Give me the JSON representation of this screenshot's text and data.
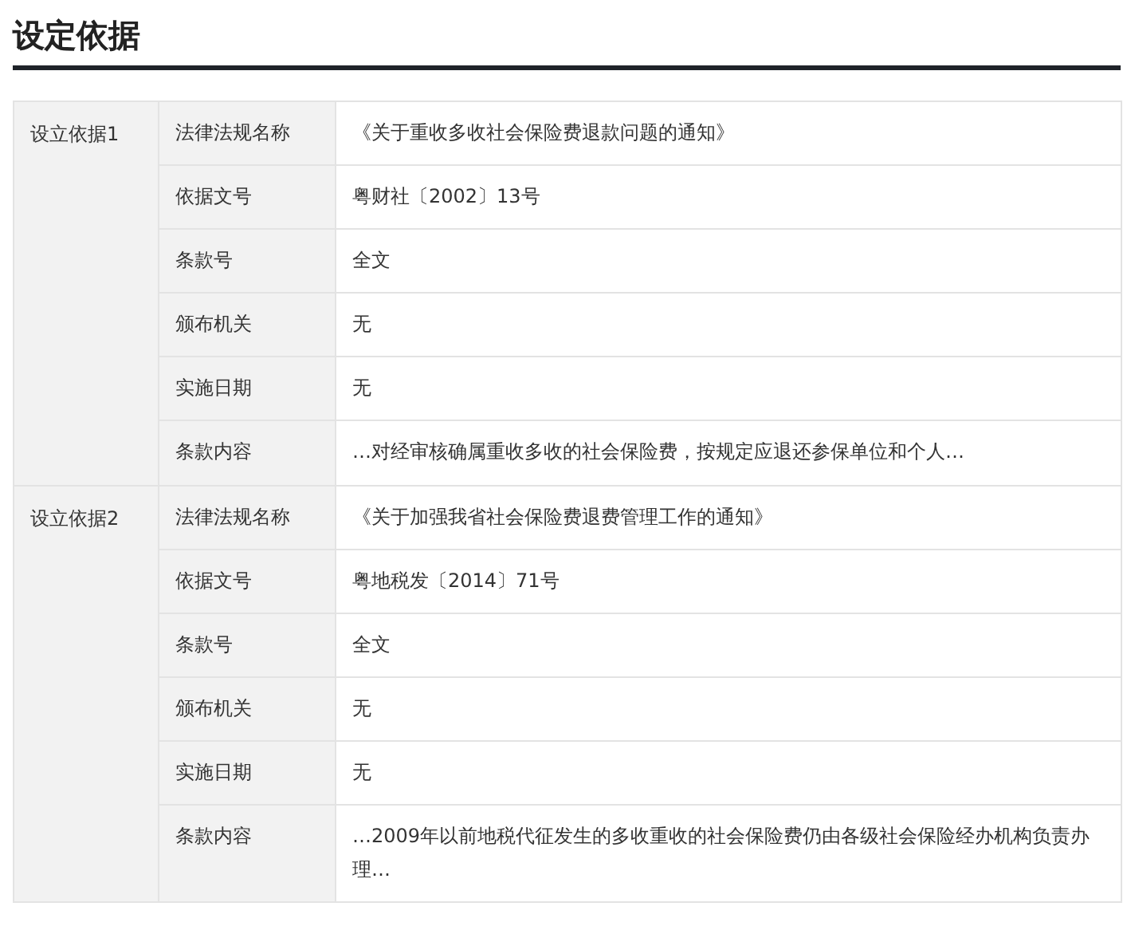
{
  "title": "设定依据",
  "bases": [
    {
      "label": "设立依据1",
      "fields": [
        {
          "name": "法律法规名称",
          "value": "《关于重收多收社会保险费退款问题的通知》"
        },
        {
          "name": "依据文号",
          "value": "粤财社〔2002〕13号"
        },
        {
          "name": "条款号",
          "value": "全文"
        },
        {
          "name": "颁布机关",
          "value": "无"
        },
        {
          "name": "实施日期",
          "value": "无"
        },
        {
          "name": "条款内容",
          "value": "…对经审核确属重收多收的社会保险费，按规定应退还参保单位和个人…"
        }
      ]
    },
    {
      "label": "设立依据2",
      "fields": [
        {
          "name": "法律法规名称",
          "value": "《关于加强我省社会保险费退费管理工作的通知》"
        },
        {
          "name": "依据文号",
          "value": "粤地税发〔2014〕71号"
        },
        {
          "name": "条款号",
          "value": "全文"
        },
        {
          "name": "颁布机关",
          "value": "无"
        },
        {
          "name": "实施日期",
          "value": "无"
        },
        {
          "name": "条款内容",
          "value": "…2009年以前地税代征发生的多收重收的社会保险费仍由各级社会保险经办机构负责办理…"
        }
      ]
    }
  ]
}
